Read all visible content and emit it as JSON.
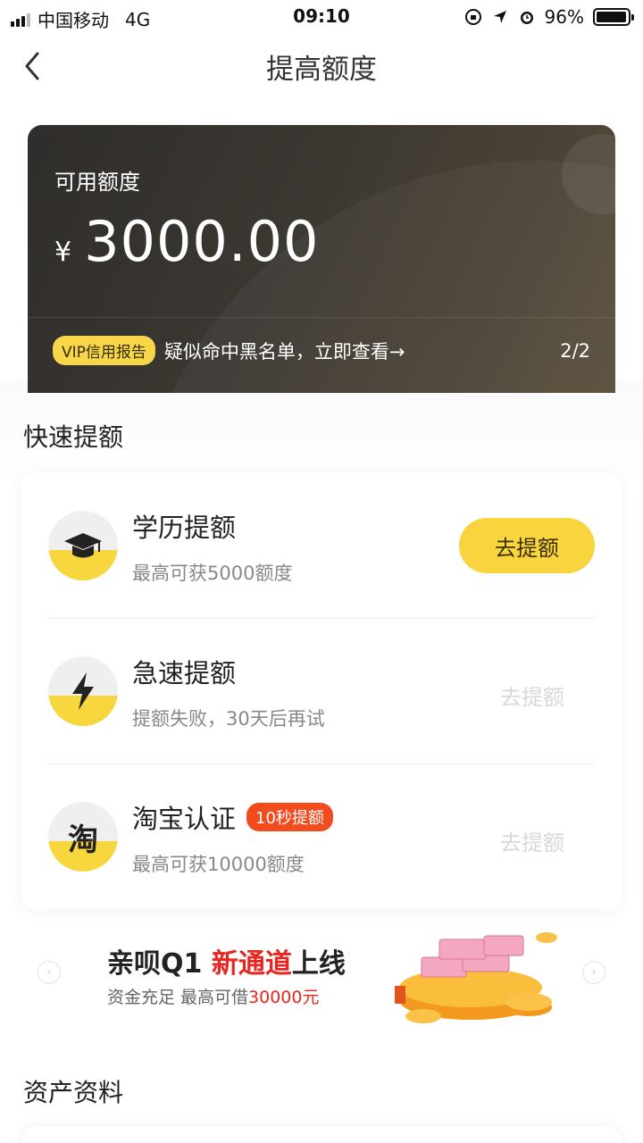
{
  "status_bar": {
    "carrier": "中国移动",
    "network": "4G",
    "time": "09:10",
    "battery": "96%",
    "battery_level": 0.96
  },
  "nav": {
    "title": "提高额度"
  },
  "credit_card": {
    "label": "可用额度",
    "currency": "¥",
    "amount": "3000.00",
    "notice_badge": "VIP信用报告",
    "notice_text": "疑似命中黑名单，立即查看→",
    "notice_page": "2/2"
  },
  "quick_section": {
    "title": "快速提额",
    "items": [
      {
        "title": "学历提额",
        "subtitle": "最高可获5000额度",
        "button": "去提额",
        "enabled": true,
        "icon": "graduation-cap-icon"
      },
      {
        "title": "急速提额",
        "subtitle": "提额失败，30天后再试",
        "button": "去提额",
        "enabled": false,
        "icon": "lightning-icon"
      },
      {
        "title": "淘宝认证",
        "tag": "10秒提额",
        "subtitle": "最高可获10000额度",
        "button": "去提额",
        "enabled": false,
        "icon": "taobao-icon",
        "icon_char": "淘"
      }
    ]
  },
  "banner": {
    "title_prefix": "亲呗Q1 ",
    "title_highlight": "新通道",
    "title_suffix": "上线",
    "sub_prefix": "资金充足 最高可借",
    "sub_highlight": "30000元",
    "prev_arrow": "‹",
    "next_arrow": "›"
  },
  "assets_section": {
    "title": "资产资料"
  },
  "colors": {
    "accent_yellow": "#f8d53f",
    "tag_red": "#f24b1e",
    "highlight_red": "#e8261f",
    "card_dark": "#3c3832"
  }
}
